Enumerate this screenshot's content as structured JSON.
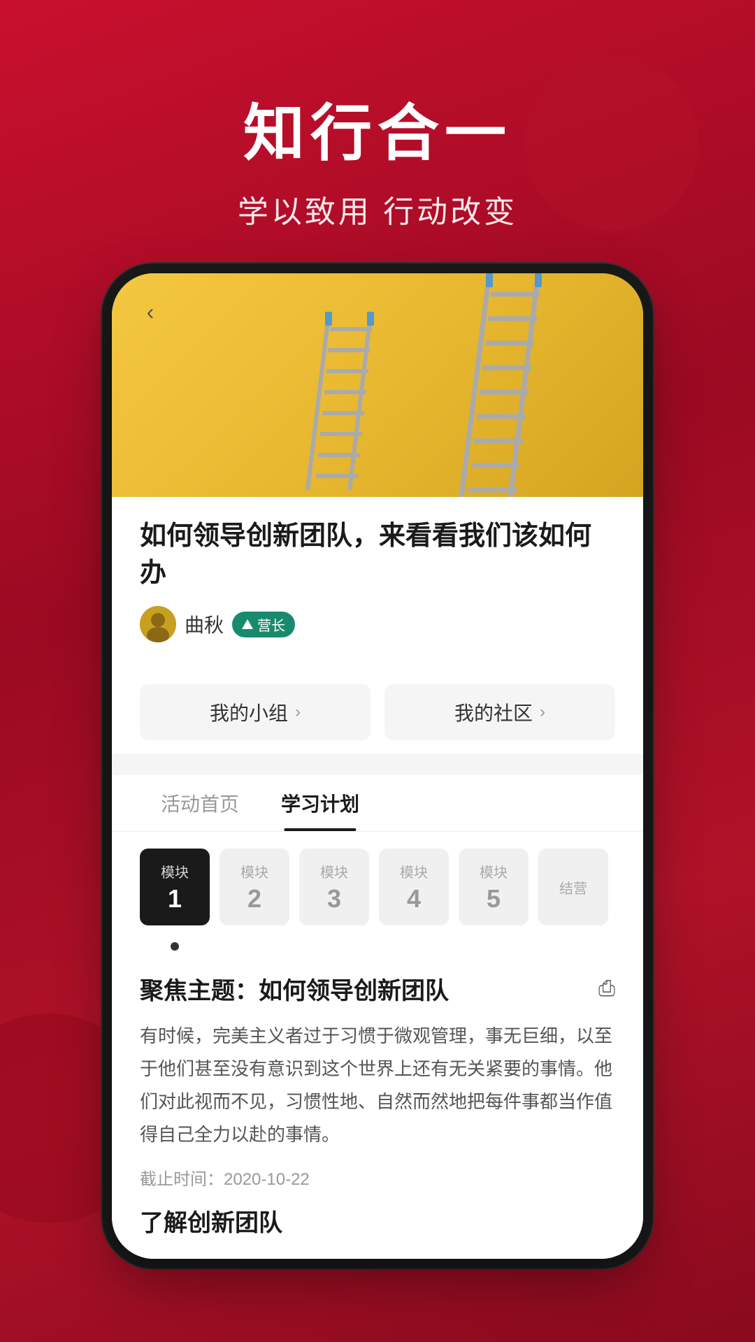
{
  "hero": {
    "title": "知行合一",
    "subtitle": "学以致用 行动改变"
  },
  "phone": {
    "back_button": "‹",
    "article": {
      "title": "如何领导创新团队，来看看我们该如何办",
      "author_name": "曲秋",
      "author_badge": "营长"
    },
    "nav": {
      "my_group": "我的小组",
      "my_community": "我的社区"
    },
    "tabs": [
      {
        "label": "活动首页",
        "active": false
      },
      {
        "label": "学习计划",
        "active": true
      }
    ],
    "modules": [
      {
        "label": "模块",
        "number": "1",
        "active": true
      },
      {
        "label": "模块",
        "number": "2",
        "active": false
      },
      {
        "label": "模块",
        "number": "3",
        "active": false
      },
      {
        "label": "模块",
        "number": "4",
        "active": false
      },
      {
        "label": "模块",
        "number": "5",
        "active": false
      },
      {
        "label": "结营",
        "number": "",
        "active": false
      }
    ],
    "focus": {
      "title": "聚焦主题：如何领导创新团队",
      "body": "有时候，完美主义者过于习惯于微观管理，事无巨细，以至于他们甚至没有意识到这个世界上还有无关紧要的事情。他们对此视而不见，习惯性地、自然而然地把每件事都当作值得自己全力以赴的事情。",
      "deadline": "截止时间：2020-10-22",
      "section_title": "了解创新团队"
    }
  }
}
